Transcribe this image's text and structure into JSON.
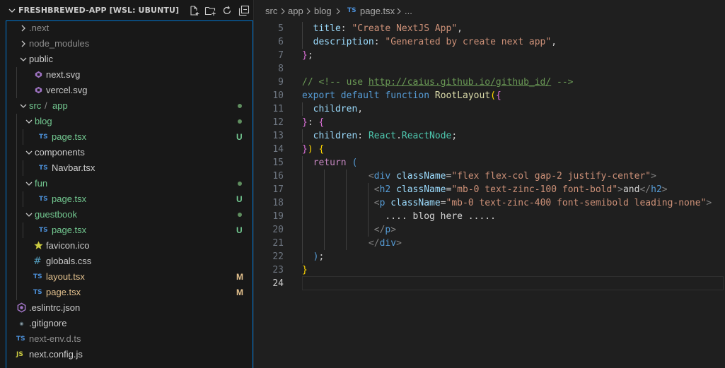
{
  "explorer": {
    "title": "FRESHBREWED-APP [WSL: UBUNTU]",
    "actions": [
      "new-file-icon",
      "new-folder-icon",
      "refresh-icon",
      "collapse-all-icon"
    ],
    "items": [
      {
        "label": ".next",
        "kind": "folder",
        "state": "collapsed",
        "color": "#8c8c8c"
      },
      {
        "label": "node_modules",
        "kind": "folder",
        "state": "collapsed",
        "color": "#8c8c8c"
      },
      {
        "label": "public",
        "kind": "folder",
        "state": "expanded",
        "color": "#cccccc"
      },
      {
        "label": "next.svg",
        "kind": "svg-file",
        "color": "#cccccc"
      },
      {
        "label": "vercel.svg",
        "kind": "svg-file",
        "color": "#cccccc"
      },
      {
        "label": "src",
        "label_sep": "/",
        "label2": "app",
        "kind": "folder",
        "state": "expanded",
        "color": "#73c991",
        "dot": true
      },
      {
        "label": "blog",
        "kind": "folder",
        "state": "expanded",
        "color": "#73c991",
        "dot": true
      },
      {
        "label": "page.tsx",
        "kind": "ts-file",
        "icon_text": "TS",
        "color": "#73c991",
        "badge": "U"
      },
      {
        "label": "components",
        "kind": "folder",
        "state": "expanded",
        "color": "#cccccc"
      },
      {
        "label": "Navbar.tsx",
        "kind": "ts-file",
        "icon_text": "TS",
        "color": "#cccccc"
      },
      {
        "label": "fun",
        "kind": "folder",
        "state": "expanded",
        "color": "#73c991",
        "dot": true
      },
      {
        "label": "page.tsx",
        "kind": "ts-file",
        "icon_text": "TS",
        "color": "#73c991",
        "badge": "U"
      },
      {
        "label": "guestbook",
        "kind": "folder",
        "state": "expanded",
        "color": "#73c991",
        "dot": true
      },
      {
        "label": "page.tsx",
        "kind": "ts-file",
        "icon_text": "TS",
        "color": "#73c991",
        "badge": "U"
      },
      {
        "label": "favicon.ico",
        "kind": "star-file",
        "color": "#cccccc"
      },
      {
        "label": "globals.css",
        "kind": "css-file",
        "icon_text": "#",
        "color": "#cccccc"
      },
      {
        "label": "layout.tsx",
        "kind": "ts-file",
        "icon_text": "TS",
        "color": "#e2c08d",
        "badge": "M"
      },
      {
        "label": "page.tsx",
        "kind": "ts-file",
        "icon_text": "TS",
        "color": "#e2c08d",
        "badge": "M"
      },
      {
        "label": ".eslintrc.json",
        "kind": "eslint-file",
        "color": "#cccccc"
      },
      {
        "label": ".gitignore",
        "kind": "git-file",
        "color": "#cccccc"
      },
      {
        "label": "next-env.d.ts",
        "kind": "ts-file",
        "icon_text": "TS",
        "color": "#8c8c8c"
      },
      {
        "label": "next.config.js",
        "kind": "js-file",
        "icon_text": "JS",
        "color": "#cccccc"
      }
    ]
  },
  "breadcrumb": {
    "parts": [
      "src",
      "app",
      "blog"
    ],
    "file_icon": "TS",
    "file": "page.tsx",
    "tail": "..."
  },
  "editor": {
    "active_line": 24,
    "lines": [
      {
        "n": "5",
        "tokens": [
          [
            "  ",
            "plain"
          ],
          [
            "title",
            "prop"
          ],
          [
            ": ",
            "pun"
          ],
          [
            "\"Create NextJS App\"",
            "str"
          ],
          [
            ",",
            "pun"
          ]
        ]
      },
      {
        "n": "6",
        "tokens": [
          [
            "  ",
            "plain"
          ],
          [
            "description",
            "prop"
          ],
          [
            ": ",
            "pun"
          ],
          [
            "\"Generated by create next app\"",
            "str"
          ],
          [
            ",",
            "pun"
          ]
        ]
      },
      {
        "n": "7",
        "tokens": [
          [
            "}",
            "br2"
          ],
          [
            ";",
            "pun"
          ]
        ]
      },
      {
        "n": "8",
        "tokens": []
      },
      {
        "n": "9",
        "tokens": [
          [
            "// <!-- use ",
            "cm"
          ],
          [
            "http://caius.github.io/github_id/",
            "link"
          ],
          [
            " -->",
            "cm"
          ]
        ]
      },
      {
        "n": "10",
        "tokens": [
          [
            "export",
            "kw"
          ],
          [
            " ",
            "plain"
          ],
          [
            "default",
            "kw"
          ],
          [
            " ",
            "plain"
          ],
          [
            "function",
            "kw"
          ],
          [
            " ",
            "plain"
          ],
          [
            "RootLayout",
            "fn"
          ],
          [
            "(",
            "br"
          ],
          [
            "{",
            "br2"
          ]
        ]
      },
      {
        "n": "11",
        "tokens": [
          [
            "  ",
            "plain"
          ],
          [
            "children",
            "prop"
          ],
          [
            ",",
            "pun"
          ]
        ]
      },
      {
        "n": "12",
        "tokens": [
          [
            "}",
            "br2"
          ],
          [
            ": ",
            "pun"
          ],
          [
            "{",
            "br2"
          ]
        ]
      },
      {
        "n": "13",
        "tokens": [
          [
            "  ",
            "plain"
          ],
          [
            "children",
            "prop"
          ],
          [
            ": ",
            "pun"
          ],
          [
            "React",
            "type"
          ],
          [
            ".",
            "pun"
          ],
          [
            "ReactNode",
            "type"
          ],
          [
            ";",
            "pun"
          ]
        ]
      },
      {
        "n": "14",
        "tokens": [
          [
            "}",
            "br2"
          ],
          [
            ")",
            "br"
          ],
          [
            " ",
            "plain"
          ],
          [
            "{",
            "br"
          ]
        ]
      },
      {
        "n": "15",
        "tokens": [
          [
            "  ",
            "plain"
          ],
          [
            "return",
            "kw2"
          ],
          [
            " ",
            "plain"
          ],
          [
            "(",
            "kw"
          ]
        ]
      },
      {
        "n": "16",
        "tokens": [
          [
            "            ",
            "plain"
          ],
          [
            "<",
            "tag"
          ],
          [
            "div",
            "tagn"
          ],
          [
            " ",
            "plain"
          ],
          [
            "className",
            "attr"
          ],
          [
            "=",
            "pun"
          ],
          [
            "\"flex flex-col gap-2 justify-center\"",
            "str"
          ],
          [
            ">",
            "tag"
          ]
        ]
      },
      {
        "n": "17",
        "tokens": [
          [
            "             ",
            "plain"
          ],
          [
            "<",
            "tag"
          ],
          [
            "h2",
            "tagn"
          ],
          [
            " ",
            "plain"
          ],
          [
            "className",
            "attr"
          ],
          [
            "=",
            "pun"
          ],
          [
            "\"mb-0 text-zinc-100 font-bold\"",
            "str"
          ],
          [
            ">",
            "tag"
          ],
          [
            "and",
            "txt"
          ],
          [
            "</",
            "tag"
          ],
          [
            "h2",
            "tagn"
          ],
          [
            ">",
            "tag"
          ]
        ]
      },
      {
        "n": "18",
        "tokens": [
          [
            "             ",
            "plain"
          ],
          [
            "<",
            "tag"
          ],
          [
            "p",
            "tagn"
          ],
          [
            " ",
            "plain"
          ],
          [
            "className",
            "attr"
          ],
          [
            "=",
            "pun"
          ],
          [
            "\"mb-0 text-zinc-400 font-semibold leading-none\"",
            "str"
          ],
          [
            ">",
            "tag"
          ]
        ]
      },
      {
        "n": "19",
        "tokens": [
          [
            "               ",
            "plain"
          ],
          [
            ".... blog here .....",
            "txt"
          ]
        ]
      },
      {
        "n": "20",
        "tokens": [
          [
            "             ",
            "plain"
          ],
          [
            "</",
            "tag"
          ],
          [
            "p",
            "tagn"
          ],
          [
            ">",
            "tag"
          ]
        ]
      },
      {
        "n": "21",
        "tokens": [
          [
            "            ",
            "plain"
          ],
          [
            "</",
            "tag"
          ],
          [
            "div",
            "tagn"
          ],
          [
            ">",
            "tag"
          ]
        ]
      },
      {
        "n": "22",
        "tokens": [
          [
            "  ",
            "plain"
          ],
          [
            ")",
            "kw"
          ],
          [
            ";",
            "pun"
          ]
        ]
      },
      {
        "n": "23",
        "tokens": [
          [
            "}",
            "br"
          ]
        ]
      },
      {
        "n": "24",
        "tokens": []
      }
    ]
  }
}
